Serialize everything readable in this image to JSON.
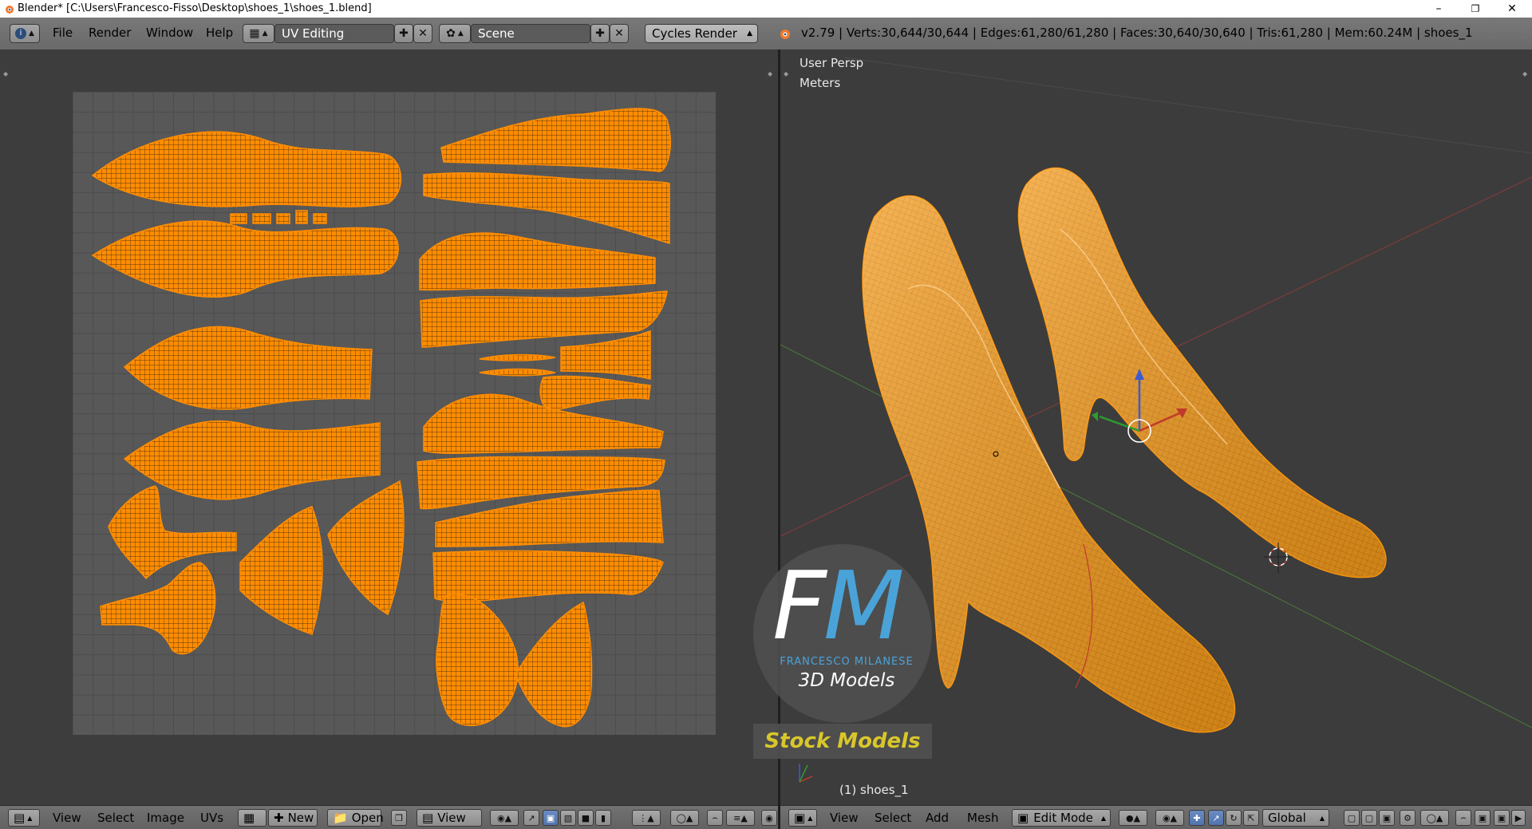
{
  "window": {
    "title": "Blender* [C:\\Users\\Francesco-Fisso\\Desktop\\shoes_1\\shoes_1.blend]",
    "minimize": "–",
    "restore": "❐",
    "close": "✕"
  },
  "info_header": {
    "menus": [
      "File",
      "Render",
      "Window",
      "Help"
    ],
    "screen_layout": "UV Editing",
    "scene": "Scene",
    "render_engine": "Cycles Render",
    "stats": "v2.79 | Verts:30,644/30,644 | Edges:61,280/61,280 | Faces:30,640/30,640 | Tris:61,280 | Mem:60.24M | shoes_1"
  },
  "viewport": {
    "view_name": "User Persp",
    "units": "Meters",
    "object_label": "(1) shoes_1"
  },
  "uv_footer": {
    "menus": [
      "View",
      "Select",
      "Image",
      "UVs"
    ],
    "new_label": "New",
    "open_label": "Open",
    "view_label": "View"
  },
  "vp_footer": {
    "menus": [
      "View",
      "Select",
      "Add",
      "Mesh"
    ],
    "mode": "Edit Mode",
    "orientation": "Global"
  },
  "watermark": {
    "logo_letters": "FM",
    "name": "FRANCESCO MILANESE",
    "subtitle": "3D Models",
    "banner": "Stock Models"
  },
  "colors": {
    "mesh_orange": "#ff8c00",
    "uv_grid": "#585858",
    "logo_blue": "#4aa3d8",
    "banner_yellow": "#d9c72a"
  }
}
